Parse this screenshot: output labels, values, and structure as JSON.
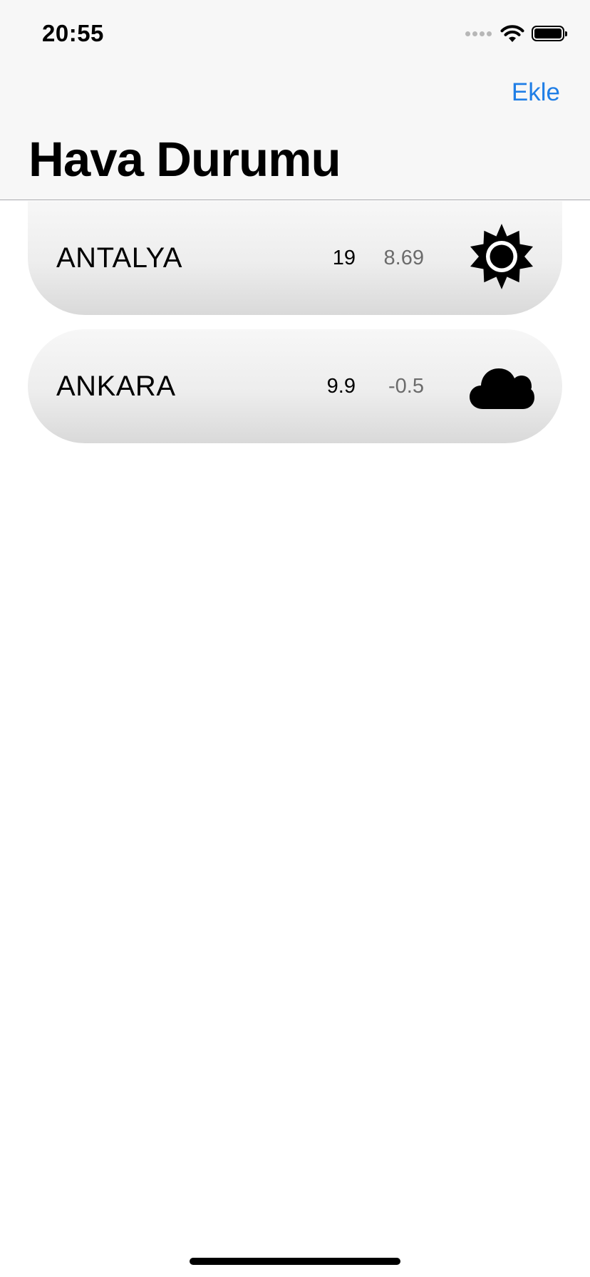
{
  "status_bar": {
    "time": "20:55",
    "icons": [
      "cellular-signal-icon",
      "wifi-icon",
      "battery-icon"
    ]
  },
  "nav": {
    "title": "Hava Durumu",
    "add_label": "Ekle"
  },
  "cities": [
    {
      "name": "ANTALYA",
      "temp": "19",
      "feels_like": "8.69",
      "icon": "sun-icon"
    },
    {
      "name": "ANKARA",
      "temp": "9.9",
      "feels_like": "-0.5",
      "icon": "cloud-icon"
    }
  ],
  "colors": {
    "accent": "#1f7ee6",
    "nav_background": "#f7f7f7",
    "secondary_text": "#6b6b6b"
  }
}
